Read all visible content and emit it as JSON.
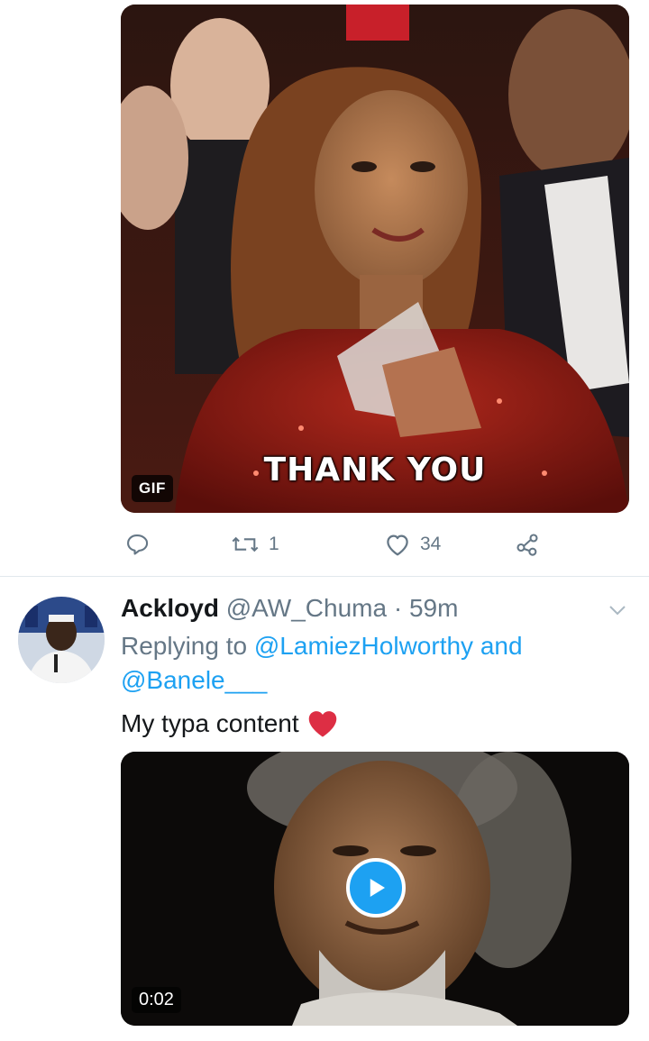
{
  "tweet1": {
    "media": {
      "caption": "THANK YOU",
      "badge": "GIF"
    },
    "actions": {
      "reply_icon": "reply-icon",
      "retweet_icon": "retweet-icon",
      "retweet_count": "1",
      "like_icon": "heart-icon",
      "like_count": "34",
      "share_icon": "share-icon"
    }
  },
  "tweet2": {
    "author_name": "Ackloyd",
    "handle": "@AW_Chuma",
    "separator": "·",
    "time": "59m",
    "replying_prefix": "Replying to",
    "reply_user1": "@LamiezHolworthy",
    "reply_and": "and",
    "reply_user2": "@Banele___",
    "text": "My typa content",
    "emoji": "heart-emoji",
    "media": {
      "duration": "0:02",
      "play_icon": "play-icon"
    }
  },
  "colors": {
    "accent": "#1da1f2",
    "muted": "#657786",
    "text": "#14171a",
    "divider": "#e1e8ed",
    "heart_emoji": "#e0245e"
  }
}
